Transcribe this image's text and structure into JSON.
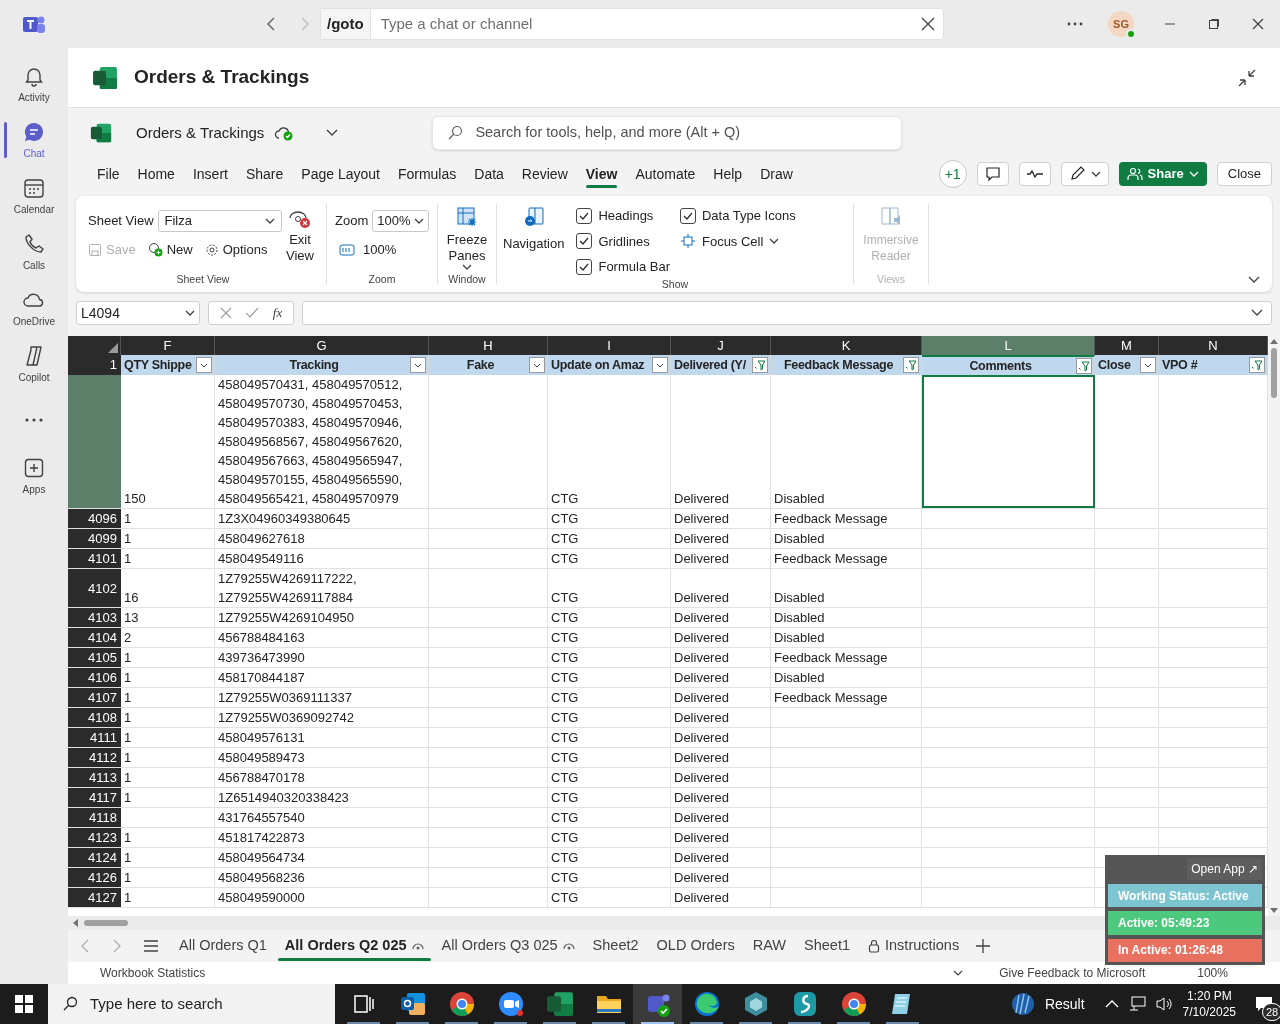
{
  "teams": {
    "goto": "/goto",
    "search_placeholder": "Type a chat or channel",
    "avatar": "SG"
  },
  "rail": [
    {
      "kind": "activity",
      "label": "Activity",
      "selected": false
    },
    {
      "kind": "chat",
      "label": "Chat",
      "selected": true
    },
    {
      "kind": "calendar",
      "label": "Calendar",
      "selected": false
    },
    {
      "kind": "calls",
      "label": "Calls",
      "selected": false
    },
    {
      "kind": "onedrive",
      "label": "OneDrive",
      "selected": false
    },
    {
      "kind": "copilot",
      "label": "Copilot",
      "selected": false
    },
    {
      "kind": "more",
      "selected": false
    },
    {
      "kind": "apps",
      "label": "Apps",
      "selected": false
    }
  ],
  "file_title": "Orders & Trackings",
  "excel": {
    "doc_name": "Orders & Trackings",
    "search_placeholder": "Search for tools, help, and more (Alt + Q)",
    "menu": [
      {
        "label": "File",
        "selected": false
      },
      {
        "label": "Home",
        "selected": false
      },
      {
        "label": "Insert",
        "selected": false
      },
      {
        "label": "Share",
        "selected": false
      },
      {
        "label": "Page Layout",
        "selected": false
      },
      {
        "label": "Formulas",
        "selected": false
      },
      {
        "label": "Data",
        "selected": false
      },
      {
        "label": "Review",
        "selected": false
      },
      {
        "label": "View",
        "selected": true
      },
      {
        "label": "Automate",
        "selected": false
      },
      {
        "label": "Help",
        "selected": false
      },
      {
        "label": "Draw",
        "selected": false
      }
    ],
    "presence": "+1",
    "share": "Share",
    "close": "Close"
  },
  "ribbon": {
    "sheet_view": {
      "label": "Sheet View",
      "value": "Filza",
      "save": {
        "label": "Save",
        "disabled": true
      },
      "new": "New",
      "options": "Options",
      "exit": "Exit View",
      "group": "Sheet View"
    },
    "zoom": {
      "label": "Zoom",
      "value": "100%",
      "reset": "100%",
      "group": "Zoom"
    },
    "window": {
      "freeze": "Freeze Panes",
      "group": "Window"
    },
    "show": {
      "navigation": "Navigation",
      "checks": [
        {
          "label": "Headings",
          "checked": true
        },
        {
          "label": "Gridlines",
          "checked": true
        },
        {
          "label": "Formula Bar",
          "checked": true
        },
        {
          "label": "Data Type Icons",
          "checked": true
        }
      ],
      "focus": "Focus Cell",
      "group": "Show"
    },
    "views": {
      "reader": {
        "label": "Immersive Reader",
        "disabled": true
      },
      "group": "Views"
    }
  },
  "formula_bar": {
    "name_box": "L4094",
    "fx": "fx"
  },
  "grid": {
    "columns": [
      {
        "letter": "F",
        "title": "QTY Shippe",
        "filtered": false,
        "selected": false
      },
      {
        "letter": "G",
        "title": "Tracking",
        "filtered": false,
        "selected": false
      },
      {
        "letter": "H",
        "title": "Fake",
        "filtered": false,
        "selected": false
      },
      {
        "letter": "I",
        "title": "Update on Amaz",
        "filtered": false,
        "selected": false
      },
      {
        "letter": "J",
        "title": "Delivered (Y/",
        "filtered": true,
        "selected": false
      },
      {
        "letter": "K",
        "title": "Feedback Message",
        "filtered": true,
        "selected": false
      },
      {
        "letter": "L",
        "title": "Comments",
        "filtered": true,
        "selected": true
      },
      {
        "letter": "M",
        "title": "Close",
        "filtered": false,
        "selected": false
      },
      {
        "letter": "N",
        "title": "VPO #",
        "filtered": true,
        "selected": false
      }
    ],
    "header_row": "1",
    "rows": [
      {
        "selected": true,
        "cells": {
          "F": "150",
          "G": "458049570431, 458049570512,\n458049570730, 458049570453,\n458049570383, 458049570946,\n458049568567, 458049567620,\n458049567663, 458049565947,\n458049570155, 458049565590,\n458049565421, 458049570979",
          "I": "CTG",
          "J": "Delivered",
          "K": "Disabled"
        }
      },
      {
        "number": "4096",
        "selected": false,
        "cells": {
          "F": "1",
          "G": "1Z3X04960349380645",
          "I": "CTG",
          "J": "Delivered",
          "K": "Feedback Message"
        }
      },
      {
        "number": "4099",
        "selected": false,
        "cells": {
          "F": "1",
          "G": "458049627618",
          "I": "CTG",
          "J": "Delivered",
          "K": "Disabled"
        }
      },
      {
        "number": "4101",
        "selected": false,
        "cells": {
          "F": "1",
          "G": "458049549116",
          "I": "CTG",
          "J": "Delivered",
          "K": "Feedback Message"
        }
      },
      {
        "number": "4102",
        "selected": false,
        "cells": {
          "F": "16",
          "G": "1Z79255W4269117222,\n1Z79255W4269117884",
          "I": "CTG",
          "J": "Delivered",
          "K": "Disabled"
        }
      },
      {
        "number": "4103",
        "selected": false,
        "cells": {
          "F": "13",
          "G": "1Z79255W4269104950",
          "I": "CTG",
          "J": "Delivered",
          "K": "Disabled"
        }
      },
      {
        "number": "4104",
        "selected": false,
        "cells": {
          "F": "2",
          "G": "456788484163",
          "I": "CTG",
          "J": "Delivered",
          "K": "Disabled"
        }
      },
      {
        "number": "4105",
        "selected": false,
        "cells": {
          "F": "1",
          "G": "439736473990",
          "I": "CTG",
          "J": "Delivered",
          "K": "Feedback Message"
        }
      },
      {
        "number": "4106",
        "selected": false,
        "cells": {
          "F": "1",
          "G": "458170844187",
          "I": "CTG",
          "J": "Delivered",
          "K": "Disabled"
        }
      },
      {
        "number": "4107",
        "selected": false,
        "cells": {
          "F": "1",
          "G": "1Z79255W0369111337",
          "I": "CTG",
          "J": "Delivered",
          "K": "Feedback Message"
        }
      },
      {
        "number": "4108",
        "selected": false,
        "cells": {
          "F": "1",
          "G": "1Z79255W0369092742",
          "I": "CTG",
          "J": "Delivered"
        }
      },
      {
        "number": "4111",
        "selected": false,
        "cells": {
          "F": "1",
          "G": "458049576131",
          "I": "CTG",
          "J": "Delivered"
        }
      },
      {
        "number": "4112",
        "selected": false,
        "cells": {
          "F": "1",
          "G": "458049589473",
          "I": "CTG",
          "J": "Delivered"
        }
      },
      {
        "number": "4113",
        "selected": false,
        "cells": {
          "F": "1",
          "G": "456788470178",
          "I": "CTG",
          "J": "Delivered"
        }
      },
      {
        "number": "4117",
        "selected": false,
        "cells": {
          "F": "1",
          "G": "1Z6514940320338423",
          "I": "CTG",
          "J": "Delivered"
        }
      },
      {
        "number": "4118",
        "selected": false,
        "cells": {
          "G": "431764557540",
          "I": "CTG",
          "J": "Delivered"
        }
      },
      {
        "number": "4123",
        "selected": false,
        "cells": {
          "F": "1",
          "G": "451817422873",
          "I": "CTG",
          "J": "Delivered"
        }
      },
      {
        "number": "4124",
        "selected": false,
        "cells": {
          "F": "1",
          "G": "458049564734",
          "I": "CTG",
          "J": "Delivered"
        }
      },
      {
        "number": "4126",
        "selected": false,
        "cells": {
          "F": "1",
          "G": "458049568236",
          "I": "CTG",
          "J": "Delivered"
        }
      },
      {
        "number": "4127",
        "selected": false,
        "cells": {
          "F": "1",
          "G": "458049590000",
          "I": "CTG",
          "J": "Delivered"
        }
      }
    ]
  },
  "sheets": [
    {
      "label": "All Orders Q1",
      "kind": "plain",
      "selected": false
    },
    {
      "label": "All Orders Q2 025",
      "kind": "watched",
      "selected": true
    },
    {
      "label": "All Orders Q3 025",
      "kind": "watched",
      "selected": false
    },
    {
      "label": "Sheet2",
      "kind": "plain",
      "selected": false
    },
    {
      "label": "OLD Orders",
      "kind": "plain",
      "selected": false
    },
    {
      "label": "RAW",
      "kind": "plain",
      "selected": false
    },
    {
      "label": "Sheet1",
      "kind": "plain",
      "selected": false
    },
    {
      "label": "Instructions",
      "kind": "locked",
      "selected": false
    }
  ],
  "status_bar": {
    "left": "Workbook Statistics",
    "feedback": "Give Feedback to Microsoft",
    "zoom": "100%"
  },
  "widget": {
    "open": "Open App ↗",
    "status": "Working Status: Active",
    "active": "Active: 05:49:23",
    "inactive": "In Active: 01:26:48"
  },
  "taskbar": {
    "search_placeholder": "Type here to search",
    "apps": [
      {
        "kind": "taskview",
        "selected": false
      },
      {
        "kind": "outlook",
        "selected": false
      },
      {
        "kind": "chrome",
        "selected": false
      },
      {
        "kind": "zoom",
        "selected": false
      },
      {
        "kind": "excel",
        "selected": false
      },
      {
        "kind": "folder",
        "selected": false
      },
      {
        "kind": "teams",
        "selected": true
      },
      {
        "kind": "edge",
        "selected": false
      },
      {
        "kind": "cube",
        "selected": false
      },
      {
        "kind": "surf",
        "selected": false
      },
      {
        "kind": "chrome",
        "selected": false
      },
      {
        "kind": "notepad",
        "selected": false
      }
    ],
    "weather": "Result",
    "time": "1:20 PM",
    "date": "7/10/2025",
    "notifications": "28"
  }
}
